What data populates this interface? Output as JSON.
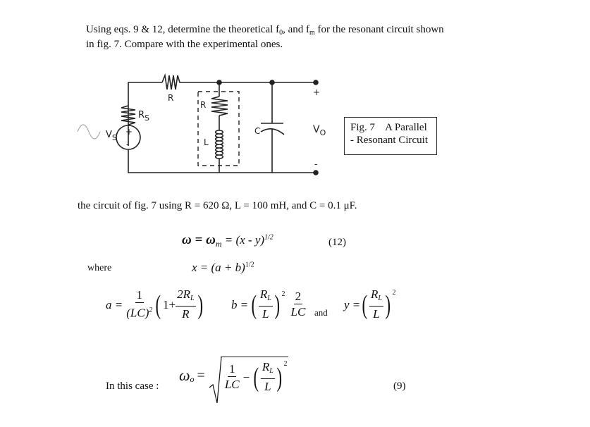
{
  "intro": {
    "line1_a": "Using eqs. 9 & 12, determine the theoretical f",
    "sub0": "0",
    "line1_b": ", and f",
    "subm": "m",
    "line1_c": " for the resonant circuit shown",
    "line2": "in fig. 7. Compare with the experimental ones."
  },
  "circuit": {
    "labels": {
      "R": "R",
      "Rs_main": "R",
      "Rs_sub": "S",
      "Vs_main": "V",
      "Vs_sub": "S",
      "plus": "+",
      "minus": "-",
      "RL": "R",
      "L": "L",
      "C": "C",
      "Vo_main": "V",
      "Vo_sub": "O",
      "out_plus": "+",
      "out_minus": "-"
    },
    "icons": [
      "ac-sine-icon",
      "voltage-source-icon",
      "resistor-icon",
      "inductor-icon",
      "capacitor-icon"
    ]
  },
  "caption": {
    "line1": "Fig. 7    A Parallel",
    "line2": "- Resonant Circuit"
  },
  "values_text": "the circuit of fig. 7 using R = 620 Ω, L = 100 mH, and C = 0.1 μF.",
  "eq12": {
    "lhs": "ω = ω",
    "lhs_sub": "m",
    "rhs": " = (x - y)",
    "rhs_sup": "1/2",
    "number": "(12)"
  },
  "where": "where",
  "xeq": {
    "text": "x = (a + b)",
    "sup": "1/2"
  },
  "eq_a": {
    "lhs": "a =",
    "num": "1",
    "den": "(LC)",
    "den_sup": "2",
    "inner_one": "1+",
    "inner_num": "2R",
    "inner_num_sub": "L",
    "inner_den": "R"
  },
  "eq_b": {
    "lhs": "b =",
    "num": "R",
    "num_sub": "L",
    "den": "L",
    "sup": "2",
    "num2": "2",
    "den2": "LC"
  },
  "and": "and",
  "eq_y": {
    "lhs": "y =",
    "num": "R",
    "num_sub": "L",
    "den": "L",
    "sup": "2"
  },
  "in_this_case": "In this case :",
  "eq9": {
    "lhs": "ω",
    "lhs_sub": "o",
    "eq": "=",
    "num1": "1",
    "den1": "LC",
    "minus": "−",
    "num2": "R",
    "num2_sub": "L",
    "den2": "L",
    "sup": "2",
    "number": "(9)"
  }
}
